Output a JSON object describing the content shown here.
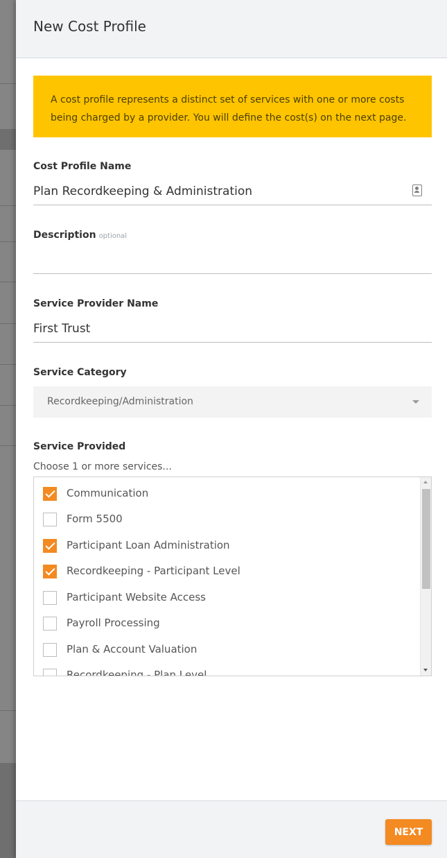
{
  "panel": {
    "title": "New Cost Profile"
  },
  "notice": {
    "text": "A cost profile represents a distinct set of services with one or more costs being charged by a provider. You will define the cost(s) on the next page.",
    "color": "#ffc400"
  },
  "form": {
    "cost_profile_name": {
      "label": "Cost Profile Name",
      "value": "Plan Recordkeeping & Administration"
    },
    "description": {
      "label": "Description",
      "optional_tag": "optional",
      "value": ""
    },
    "service_provider_name": {
      "label": "Service Provider Name",
      "value": "First Trust"
    },
    "service_category": {
      "label": "Service Category",
      "value": "Recordkeeping/Administration"
    },
    "service_provided": {
      "label": "Service Provided",
      "hint": "Choose 1 or more services...",
      "items": [
        {
          "label": "Communication",
          "checked": true
        },
        {
          "label": "Form 5500",
          "checked": false
        },
        {
          "label": "Participant Loan Administration",
          "checked": true
        },
        {
          "label": "Recordkeeping - Participant Level",
          "checked": true
        },
        {
          "label": "Participant Website Access",
          "checked": false
        },
        {
          "label": "Payroll Processing",
          "checked": false
        },
        {
          "label": "Plan & Account Valuation",
          "checked": false
        },
        {
          "label": "Recordkeeping - Plan Level",
          "checked": false
        }
      ]
    }
  },
  "footer": {
    "next_label": "NEXT"
  },
  "colors": {
    "accent": "#f38a22",
    "notice": "#ffc400"
  }
}
